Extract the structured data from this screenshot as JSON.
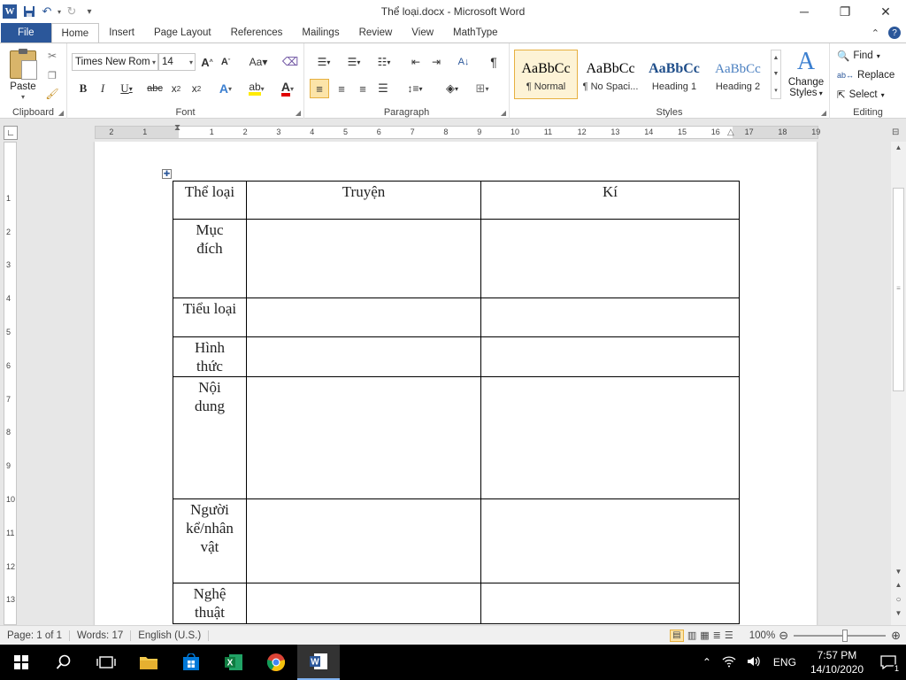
{
  "window": {
    "title": "Thể loại.docx - Microsoft Word"
  },
  "tabs": [
    "File",
    "Home",
    "Insert",
    "Page Layout",
    "References",
    "Mailings",
    "Review",
    "View",
    "MathType"
  ],
  "ribbon": {
    "paste_label": "Paste",
    "font_name": "Times New Rom",
    "font_size": "14",
    "styles": [
      {
        "preview": "AaBbCc",
        "name": "¶ Normal"
      },
      {
        "preview": "AaBbCc",
        "name": "¶ No Spaci..."
      },
      {
        "preview": "AaBbCc",
        "name": "Heading 1"
      },
      {
        "preview": "AaBbCc",
        "name": "Heading 2"
      }
    ],
    "change_styles_1": "Change",
    "change_styles_2": "Styles",
    "find": "Find",
    "replace": "Replace",
    "select": "Select",
    "groups": {
      "clipboard": "Clipboard",
      "font": "Font",
      "paragraph": "Paragraph",
      "styles": "Styles",
      "editing": "Editing"
    }
  },
  "ruler_numbers": [
    "2",
    "1",
    "1",
    "2",
    "3",
    "4",
    "5",
    "6",
    "7",
    "8",
    "9",
    "10",
    "11",
    "12",
    "13",
    "14",
    "15",
    "16",
    "17",
    "18",
    "19"
  ],
  "table": {
    "headers": [
      "Thể loại",
      "Truyện",
      "Kí"
    ],
    "rows": [
      {
        "label_lines": [
          "Mục",
          "đích"
        ]
      },
      {
        "label_lines": [
          "Tiểu loại"
        ]
      },
      {
        "label_lines": [
          "Hình",
          "thức"
        ]
      },
      {
        "label_lines": [
          "Nội",
          "dung"
        ]
      },
      {
        "label_lines": [
          "Người",
          "kể/nhân",
          "vật"
        ]
      },
      {
        "label_lines": [
          "Nghệ",
          "thuật"
        ]
      }
    ]
  },
  "status": {
    "page": "Page: 1 of 1",
    "words": "Words: 17",
    "language": "English (U.S.)",
    "zoom": "100%"
  },
  "taskbar": {
    "lang": "ENG",
    "time": "7:57 PM",
    "date": "14/10/2020",
    "notif_count": "1"
  }
}
